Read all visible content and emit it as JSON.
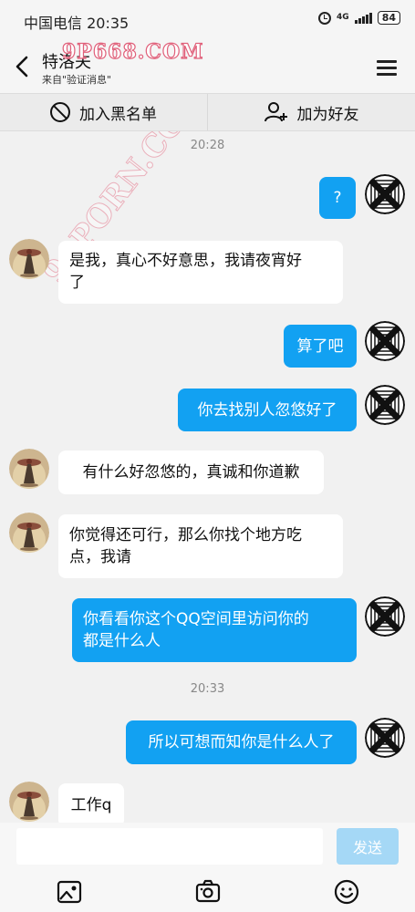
{
  "status_bar": {
    "carrier": "中国电信",
    "time": "20:35",
    "network": "4G",
    "battery": "84"
  },
  "header": {
    "title": "特洛夫",
    "subtitle": "来自\"验证消息\""
  },
  "watermarks": {
    "top": "9P668.COM",
    "diagonal": "91PORN.COM"
  },
  "actions": {
    "block_label": "加入黑名单",
    "add_friend_label": "加为好友"
  },
  "chat": {
    "timestamps": [
      "20:28",
      "20:33"
    ],
    "messages": [
      {
        "side": "out",
        "text": "?"
      },
      {
        "side": "in",
        "lines": [
          "是我，真心不好意思，我请夜宵好",
          "了"
        ]
      },
      {
        "side": "out",
        "text": "算了吧"
      },
      {
        "side": "out",
        "text": "你去找别人忽悠好了"
      },
      {
        "side": "in",
        "text": "有什么好忽悠的，真诚和你道歉"
      },
      {
        "side": "in",
        "lines": [
          "你觉得还可行，那么你找个地方吃",
          "点，我请"
        ]
      },
      {
        "side": "out",
        "lines": [
          "你看看你这个QQ空间里访问你的",
          "都是什么人"
        ]
      },
      {
        "side": "out",
        "text": "所以可想而知你是什么人了"
      },
      {
        "side": "in",
        "text": "工作q"
      }
    ]
  },
  "input": {
    "placeholder": "",
    "send_label": "发送"
  },
  "toolbar": {
    "icons": [
      "image-icon",
      "camera-icon",
      "emoji-icon"
    ]
  },
  "colors": {
    "outgoing_bubble": "#12a1f2",
    "incoming_bubble": "#ffffff",
    "send_disabled": "#a5d8f6",
    "background": "#f1f1f1"
  }
}
